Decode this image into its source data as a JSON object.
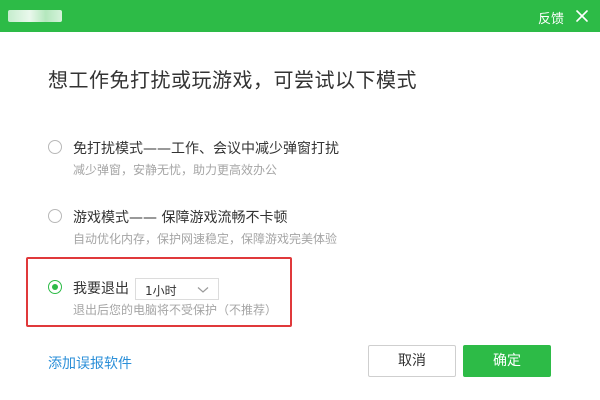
{
  "window": {
    "feedback_label": "反馈"
  },
  "headline": "想工作免打扰或玩游戏，可尝试以下模式",
  "options": [
    {
      "title": "免打扰模式——工作、会议中减少弹窗打扰",
      "desc": "减少弹窗，安静无忧，助力更高效办公",
      "checked": false
    },
    {
      "title": "游戏模式—— 保障游戏流畅不卡顿",
      "desc": "自动优化内存，保护网速稳定，保障游戏完美体验",
      "checked": false
    },
    {
      "title": "我要退出",
      "desc": "退出后您的电脑将不受保护（不推荐）",
      "checked": true
    }
  ],
  "duration_select": {
    "value": "1小时"
  },
  "footer": {
    "add_link": "添加误报软件",
    "cancel_label": "取消",
    "ok_label": "确定"
  },
  "colors": {
    "brand_green": "#2dbb47",
    "link_blue": "#2b8fd8",
    "highlight_red": "#e0393b"
  },
  "icons": {
    "close": "close-icon",
    "dropdown": "chevron-down-icon"
  }
}
